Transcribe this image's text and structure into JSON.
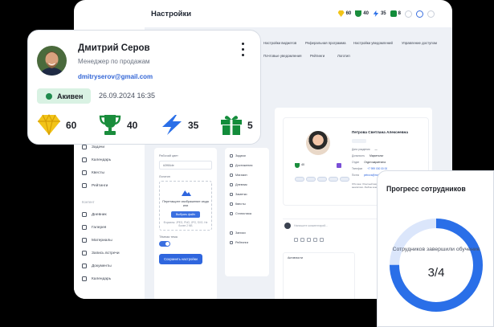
{
  "app": {
    "title": "Настройки",
    "badges": {
      "gems": "60",
      "trophies": "40",
      "bolts": "35",
      "gifts": "8"
    }
  },
  "sidebar": {
    "items": [
      {
        "label": "Задачи",
        "icon": "tasks-icon"
      },
      {
        "label": "Календарь",
        "icon": "calendar-icon"
      },
      {
        "label": "Квесты",
        "icon": "quests-icon"
      },
      {
        "label": "Рейтинги",
        "icon": "ratings-icon"
      }
    ],
    "section": "Контент",
    "items2": [
      {
        "label": "Дневник",
        "icon": "diary-icon"
      },
      {
        "label": "Галерея",
        "icon": "gallery-icon"
      },
      {
        "label": "Материалы",
        "icon": "materials-icon"
      },
      {
        "label": "Запись встречи",
        "icon": "meeting-icon"
      },
      {
        "label": "Документы",
        "icon": "documents-icon"
      },
      {
        "label": "Календарь",
        "icon": "calendar-icon"
      }
    ]
  },
  "tabs": {
    "row1": [
      "Настройки виджетов",
      "Реферальная программа",
      "Настройки уведомлений",
      "Управление доступом"
    ],
    "row2": [
      "Почтовые уведомления",
      "Рейтинги",
      "Логотип"
    ]
  },
  "settings_form": {
    "field_label": "Рабочий цвет",
    "field_value": "#2f66de",
    "upload_label": "Логотип",
    "upload_title": "Перетащите изображение сюда или",
    "upload_button": "Выбрать файл",
    "upload_hint": "Форматы: JPEG, PNG, JPG, SVG. Не более 2 МБ",
    "toggle_label": "Тёмная тема",
    "save_button": "Сохранить настройки"
  },
  "mid_menu": [
    "Задачи",
    "Достижения",
    "Магазин",
    "Дневник",
    "Заметки",
    "Квесты",
    "Статистика",
    "Записи",
    "Рейтинги"
  ],
  "employee": {
    "name": "Петрова Светлана Алексеевна",
    "rows": [
      {
        "label": "Дата рождения",
        "value": "—"
      },
      {
        "label": "Должность",
        "value": "Маркетолог"
      },
      {
        "label": "Отдел",
        "value": "Отдел маркетинга"
      },
      {
        "label": "Телефон",
        "value": "+7 999 000 00 00"
      },
      {
        "label": "Почта",
        "value": "petrova@mail.ru"
      }
    ],
    "about": "Обо мне: Опытный маркетолог с навыками digital-продвижения и аналитики. Люблю командную работу и новые задачи.",
    "comment_placeholder": "Напишите комментарий...",
    "feed_title": "Активности"
  },
  "profile_card": {
    "name": "Дмитрий Серов",
    "role": "Менеджер по продажам",
    "email": "dmitryserov@gmail.com",
    "status": "Акивен",
    "date": "26.09.2024 16:35",
    "stats": {
      "gems": "60",
      "trophies": "40",
      "bolts": "35",
      "gifts": "5"
    },
    "colors": {
      "gem": "#f2c418",
      "trophy": "#1a8d3c",
      "bolt": "#2a6fe8",
      "gift": "#128c3a",
      "status_bg": "#d9f2e3",
      "email": "#3366d6"
    }
  },
  "progress_card": {
    "title": "Прогресс сотрудников",
    "caption": "Сотрудников завершили обучение",
    "value_text": "3/4",
    "completed": 3,
    "total": 4,
    "colors": {
      "done": "#2a6fe8",
      "rest": "#dbe6fb"
    }
  }
}
